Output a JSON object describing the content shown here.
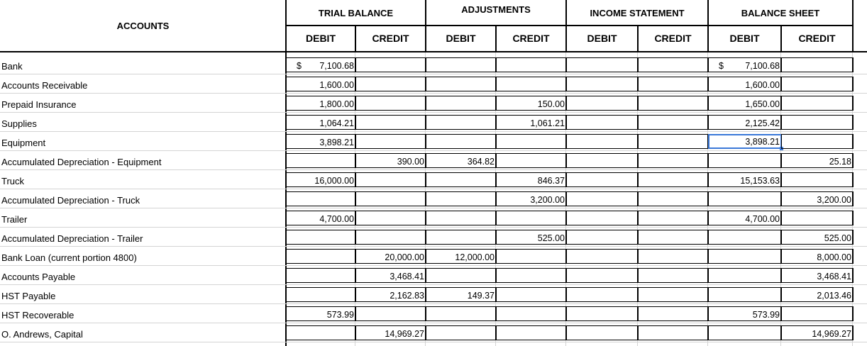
{
  "headers": {
    "accounts": "ACCOUNTS",
    "groups": [
      "TRIAL BALANCE",
      "ADJUSTMENTS",
      "INCOME STATEMENT",
      "BALANCE SHEET"
    ],
    "debit": "DEBIT",
    "credit": "CREDIT"
  },
  "currency_symbol": "$",
  "selection_color": "#3a78d8",
  "rows": [
    {
      "name": "Bank",
      "tb_debit": "7,100.68",
      "tb_credit": "",
      "adj_debit": "",
      "adj_credit": "",
      "is_debit": "",
      "is_credit": "",
      "bs_debit": "7,100.68",
      "bs_credit": ""
    },
    {
      "name": "Accounts Receivable",
      "tb_debit": "1,600.00",
      "tb_credit": "",
      "adj_debit": "",
      "adj_credit": "",
      "is_debit": "",
      "is_credit": "",
      "bs_debit": "1,600.00",
      "bs_credit": ""
    },
    {
      "name": "Prepaid Insurance",
      "tb_debit": "1,800.00",
      "tb_credit": "",
      "adj_debit": "",
      "adj_credit": "150.00",
      "is_debit": "",
      "is_credit": "",
      "bs_debit": "1,650.00",
      "bs_credit": ""
    },
    {
      "name": "Supplies",
      "tb_debit": "1,064.21",
      "tb_credit": "",
      "adj_debit": "",
      "adj_credit": "1,061.21",
      "is_debit": "",
      "is_credit": "",
      "bs_debit": "2,125.42",
      "bs_credit": ""
    },
    {
      "name": "Equipment",
      "tb_debit": "3,898.21",
      "tb_credit": "",
      "adj_debit": "",
      "adj_credit": "",
      "is_debit": "",
      "is_credit": "",
      "bs_debit": "3,898.21",
      "bs_credit": ""
    },
    {
      "name": "Accumulated Depreciation - Equipment",
      "tb_debit": "",
      "tb_credit": "390.00",
      "adj_debit": "364.82",
      "adj_credit": "",
      "is_debit": "",
      "is_credit": "",
      "bs_debit": "",
      "bs_credit": "25.18"
    },
    {
      "name": "Truck",
      "tb_debit": "16,000.00",
      "tb_credit": "",
      "adj_debit": "",
      "adj_credit": "846.37",
      "is_debit": "",
      "is_credit": "",
      "bs_debit": "15,153.63",
      "bs_credit": ""
    },
    {
      "name": "Accumulated Depreciation - Truck",
      "tb_debit": "",
      "tb_credit": "",
      "adj_debit": "",
      "adj_credit": "3,200.00",
      "is_debit": "",
      "is_credit": "",
      "bs_debit": "",
      "bs_credit": "3,200.00"
    },
    {
      "name": "Trailer",
      "tb_debit": "4,700.00",
      "tb_credit": "",
      "adj_debit": "",
      "adj_credit": "",
      "is_debit": "",
      "is_credit": "",
      "bs_debit": "4,700.00",
      "bs_credit": ""
    },
    {
      "name": "Accumulated Depreciation - Trailer",
      "tb_debit": "",
      "tb_credit": "",
      "adj_debit": "",
      "adj_credit": "525.00",
      "is_debit": "",
      "is_credit": "",
      "bs_debit": "",
      "bs_credit": "525.00"
    },
    {
      "name": "Bank Loan (current portion 4800)",
      "tb_debit": "",
      "tb_credit": "20,000.00",
      "adj_debit": "12,000.00",
      "adj_credit": "",
      "is_debit": "",
      "is_credit": "",
      "bs_debit": "",
      "bs_credit": "8,000.00"
    },
    {
      "name": "Accounts Payable",
      "tb_debit": "",
      "tb_credit": "3,468.41",
      "adj_debit": "",
      "adj_credit": "",
      "is_debit": "",
      "is_credit": "",
      "bs_debit": "",
      "bs_credit": "3,468.41"
    },
    {
      "name": "HST Payable",
      "tb_debit": "",
      "tb_credit": "2,162.83",
      "adj_debit": "149.37",
      "adj_credit": "",
      "is_debit": "",
      "is_credit": "",
      "bs_debit": "",
      "bs_credit": "2,013.46"
    },
    {
      "name": "HST Recoverable",
      "tb_debit": "573.99",
      "tb_credit": "",
      "adj_debit": "",
      "adj_credit": "",
      "is_debit": "",
      "is_credit": "",
      "bs_debit": "573.99",
      "bs_credit": ""
    },
    {
      "name": "O. Andrews, Capital",
      "tb_debit": "",
      "tb_credit": "14,969.27",
      "adj_debit": "",
      "adj_credit": "",
      "is_debit": "",
      "is_credit": "",
      "bs_debit": "",
      "bs_credit": "14,969.27"
    }
  ]
}
